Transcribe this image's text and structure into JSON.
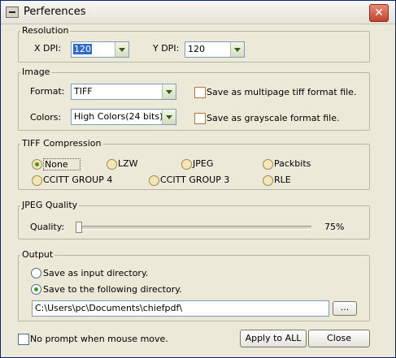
{
  "window": {
    "title": "Perferences",
    "close": "✕"
  },
  "resolution": {
    "legend": "Resolution",
    "x_label": "X DPI:",
    "x_value": "120",
    "y_label": "Y DPI:",
    "y_value": "120"
  },
  "image": {
    "legend": "Image",
    "format_label": "Format:",
    "format_value": "TIFF",
    "colors_label": "Colors:",
    "colors_value": "High Colors(24 bits)",
    "multipage_label": "Save as multipage tiff format file.",
    "grayscale_label": "Save as grayscale format file."
  },
  "tiff": {
    "legend": "TIFF Compression",
    "options": [
      "None",
      "LZW",
      "JPEG",
      "Packbits",
      "CCITT GROUP 4",
      "CCITT GROUP 3",
      "RLE"
    ],
    "selected": "None"
  },
  "jpeg": {
    "legend": "JPEG Quality",
    "quality_label": "Quality:",
    "quality_value": "75%"
  },
  "output": {
    "legend": "Output",
    "option_input": "Save as input directory.",
    "option_dir": "Save to the following directory.",
    "directory": "C:\\Users\\pc\\Documents\\chiefpdf\\",
    "browse": "..."
  },
  "footer": {
    "no_prompt_label": "No prompt when mouse move.",
    "apply_label": "Apply to ALL",
    "close_label": "Close"
  }
}
